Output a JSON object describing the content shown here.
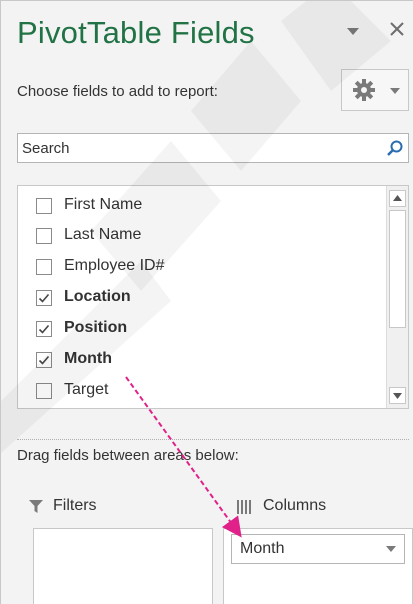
{
  "header": {
    "title": "PivotTable Fields"
  },
  "toolbar": {
    "choose_label": "Choose fields to add to report:"
  },
  "search": {
    "placeholder": "Search"
  },
  "fields": [
    {
      "label": "First Name",
      "checked": false,
      "bold": false
    },
    {
      "label": "Last Name",
      "checked": false,
      "bold": false
    },
    {
      "label": "Employee ID#",
      "checked": false,
      "bold": false
    },
    {
      "label": "Location",
      "checked": true,
      "bold": true
    },
    {
      "label": "Position",
      "checked": true,
      "bold": true
    },
    {
      "label": "Month",
      "checked": true,
      "bold": true
    },
    {
      "label": "Target",
      "checked": false,
      "bold": false
    }
  ],
  "areas": {
    "drag_label": "Drag fields between areas below:",
    "filters_label": "Filters",
    "columns_label": "Columns",
    "columns_items": [
      "Month"
    ]
  },
  "colors": {
    "title_green": "#217346",
    "arrow_magenta": "#e0218a"
  },
  "icons": {
    "title_dropdown": "chevron-down-icon",
    "close": "close-icon",
    "settings": "gear-icon",
    "search": "search-icon",
    "filter": "filter-icon",
    "columns": "columns-icon"
  }
}
